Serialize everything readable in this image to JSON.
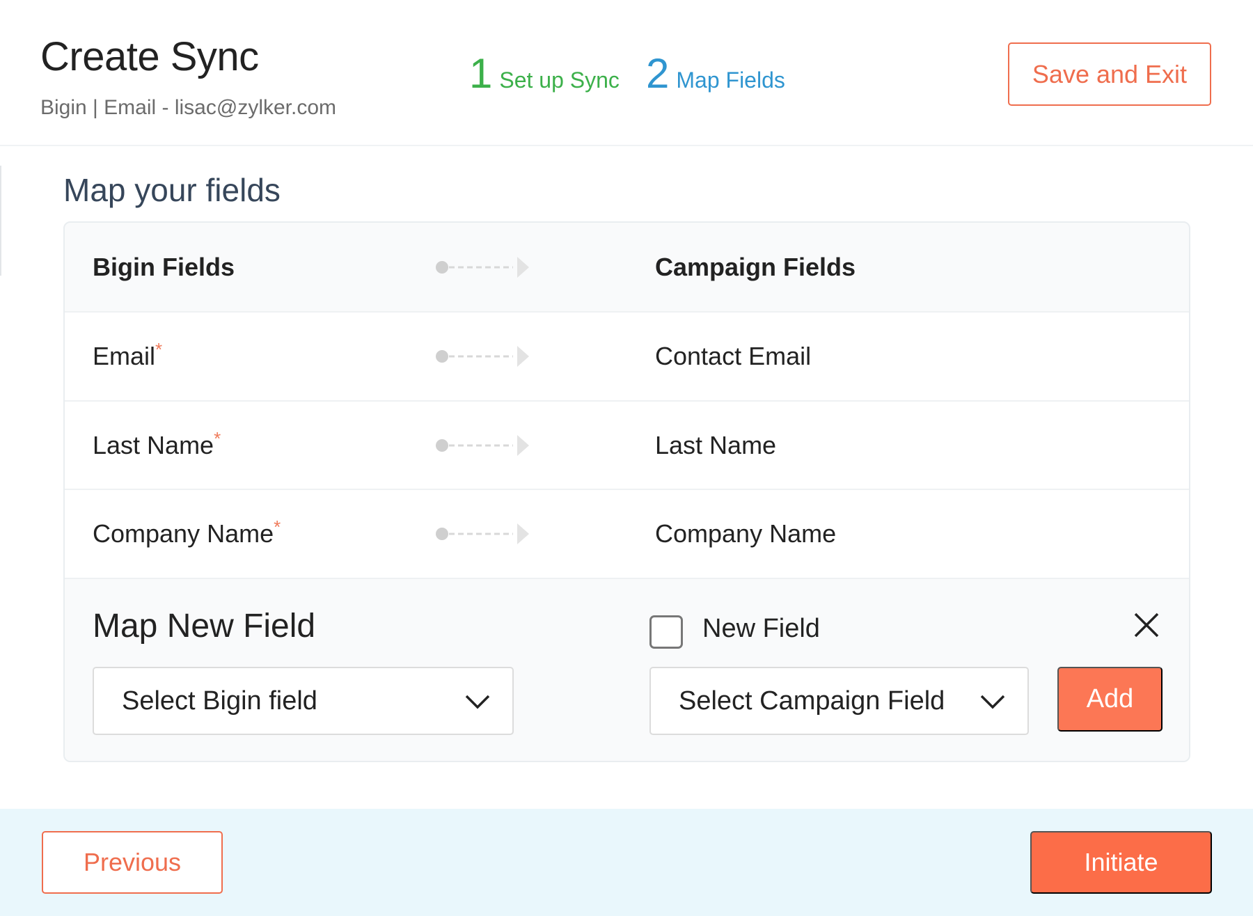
{
  "header": {
    "title": "Create Sync",
    "subtitle": "Bigin | Email - lisac@zylker.com",
    "steps": [
      {
        "number": "1",
        "label": "Set up Sync",
        "color": "#3cb04a"
      },
      {
        "number": "2",
        "label": "Map Fields",
        "color": "#2f95d0"
      }
    ],
    "save_exit_label": "Save and Exit"
  },
  "main": {
    "section_title": "Map your fields",
    "table": {
      "left_header": "Bigin Fields",
      "right_header": "Campaign Fields",
      "rows": [
        {
          "bigin_field": "Email",
          "required_mark": "*",
          "campaign_field": "Contact Email"
        },
        {
          "bigin_field": "Last Name",
          "required_mark": "*",
          "campaign_field": "Last Name"
        },
        {
          "bigin_field": "Company Name",
          "required_mark": "*",
          "campaign_field": "Company Name"
        }
      ]
    },
    "map_new": {
      "title": "Map New Field",
      "new_field_label": "New Field",
      "new_field_checked": false,
      "bigin_select_placeholder": "Select Bigin field",
      "campaign_select_placeholder": "Select Campaign Field",
      "add_label": "Add"
    }
  },
  "footer": {
    "previous_label": "Previous",
    "initiate_label": "Initiate"
  },
  "colors": {
    "accent": "#fc6d48",
    "step_done": "#3cb04a",
    "step_active": "#2f95d0",
    "footer_bg": "#e9f7fc"
  }
}
